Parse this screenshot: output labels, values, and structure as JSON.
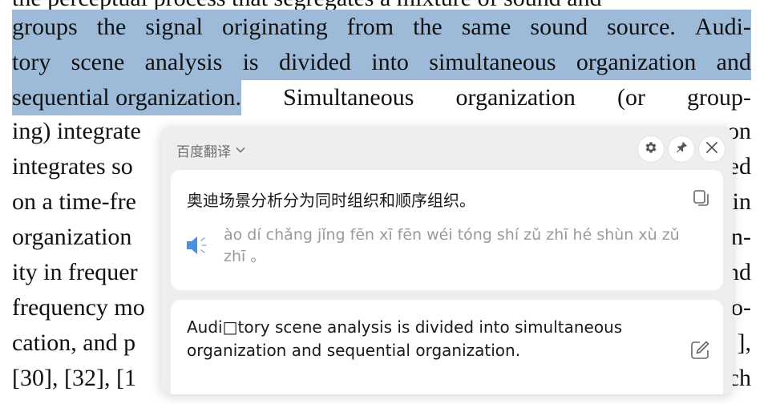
{
  "document": {
    "line0": "the perceptual process that segregates a mixture of sound and",
    "line1": [
      "groups",
      "the",
      "signal",
      "originating",
      "from",
      "the",
      "same",
      "sound",
      "source.",
      "Audi-"
    ],
    "line2": [
      "tory",
      "scene",
      "analysis",
      "is",
      "divided",
      "into",
      "simultaneous",
      "organization",
      "and"
    ],
    "line3_highlight": "sequential organization.",
    "line3_rest": [
      "Simultaneous",
      "organization",
      "(or",
      "group-"
    ],
    "line4": {
      "left": "ing) integrate",
      "right": "on"
    },
    "line5": {
      "left": "integrates so",
      "right": "ed"
    },
    "line6": {
      "left": "on a time-fre",
      "right": "in"
    },
    "line7": {
      "left": "organization",
      "right": "n-"
    },
    "line8": {
      "left": "ity in frequer",
      "right": "nd"
    },
    "line9": {
      "left": "frequency mo",
      "right": "o-"
    },
    "line10": {
      "left": "cation, and p",
      "right": "],"
    },
    "line11": {
      "left": "[30], [32], [1",
      "right": "ch"
    }
  },
  "popup": {
    "title": "百度翻译",
    "icons": {
      "settings": "gear-icon",
      "pin": "pin-icon",
      "close": "close-icon"
    },
    "source_text": "奥迪场景分析分为同时组织和顺序组织。",
    "pinyin": "ào dí chǎng jǐng fēn xī fēn wéi tóng shí zǔ zhī hé shùn xù zǔ zhī 。",
    "original_text": "Audi□tory scene analysis is divided into simultaneous organization and  sequential organization."
  },
  "colors": {
    "highlight": "#9dbbd9",
    "popup_bg": "#eeeef0",
    "speaker": "#4a8fe0"
  }
}
